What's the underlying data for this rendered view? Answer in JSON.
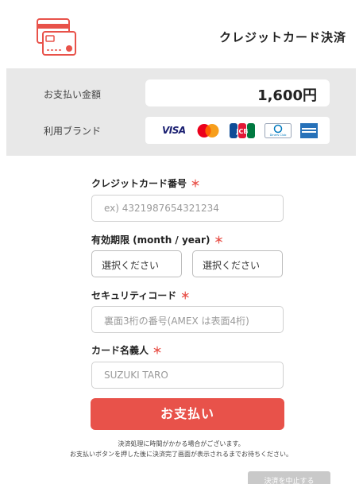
{
  "header": {
    "title": "クレジットカード決済",
    "logo_icon": "credit-card-icon",
    "accent": "#e8524a"
  },
  "summary": {
    "amount_label": "お支払い金額",
    "amount_value": "1,600円",
    "brand_label": "利用ブランド",
    "brands": {
      "visa": "VISA",
      "mastercard": "mastercard-logo",
      "jcb": "JCB",
      "diners": "Diners Club",
      "amex": "amex-logo"
    }
  },
  "form": {
    "card_number": {
      "label": "クレジットカード番号",
      "required": "＊",
      "placeholder": "ex) 4321987654321234"
    },
    "expiry": {
      "label": "有効期限 (month / year)",
      "required": "＊",
      "month": "選択ください",
      "year": "選択ください"
    },
    "security": {
      "label": "セキュリティコード",
      "required": "＊",
      "placeholder": "裏面3桁の番号(AMEX は表面4桁)"
    },
    "holder": {
      "label": "カード名義人",
      "required": "＊",
      "placeholder": "SUZUKI TARO"
    }
  },
  "pay_button": {
    "label": "お支払い",
    "color": "#e8524a"
  },
  "notes": {
    "line1": "決済処理に時間がかかる場合がございます。",
    "line2": "お支払いボタンを押した後に決済完了画面が表示されるまでお待ちください。"
  },
  "cancel_button": {
    "label": "決済を中止する"
  }
}
